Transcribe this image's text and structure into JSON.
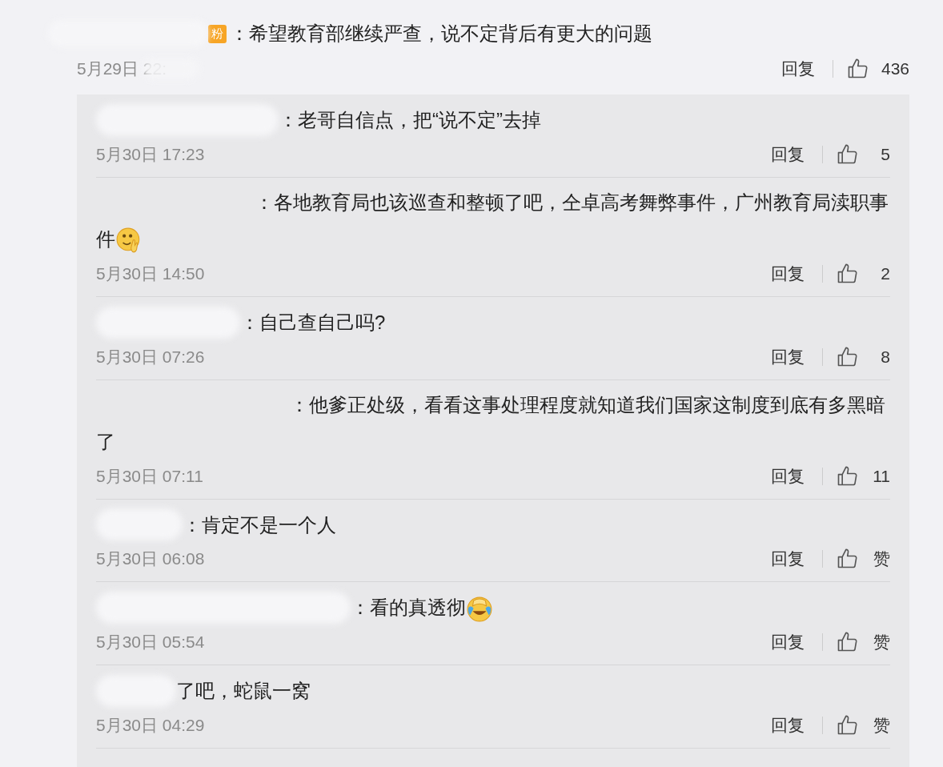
{
  "comment": {
    "badge": "粉",
    "text": "：希望教育部继续严查，说不定背后有更大的问题",
    "time": "5月29日 22:",
    "reply_label": "回复",
    "likes": "436"
  },
  "replies": [
    {
      "text": "：老哥自信点，把“说不定”去掉",
      "time": "5月30日 17:23",
      "reply_label": "回复",
      "likes": "5"
    },
    {
      "text": "：各地教育局也该巡查和整顿了吧，仝卓高考舞弊事件，广州教育局渎职事件",
      "emoji": {
        "kind": "smile"
      },
      "time": "5月30日 14:50",
      "reply_label": "回复",
      "likes": "2"
    },
    {
      "text": "：自己查自己吗?",
      "time": "5月30日 07:26",
      "reply_label": "回复",
      "likes": "8"
    },
    {
      "text": "：他爹正处级，看看这事处理程度就知道我们国家这制度到底有多黑暗了",
      "time": "5月30日 07:11",
      "reply_label": "回复",
      "likes": "11"
    },
    {
      "text": "：肯定不是一个人",
      "time": "5月30日 06:08",
      "reply_label": "回复",
      "likes": "赞"
    },
    {
      "text": "：看的真透彻",
      "emoji": {
        "kind": "laugh-cry"
      },
      "time": "5月30日 05:54",
      "reply_label": "回复",
      "likes": "赞"
    },
    {
      "text": "了吧，蛇鼠一窝",
      "time": "5月30日 04:29",
      "reply_label": "回复",
      "likes": "赞"
    }
  ]
}
